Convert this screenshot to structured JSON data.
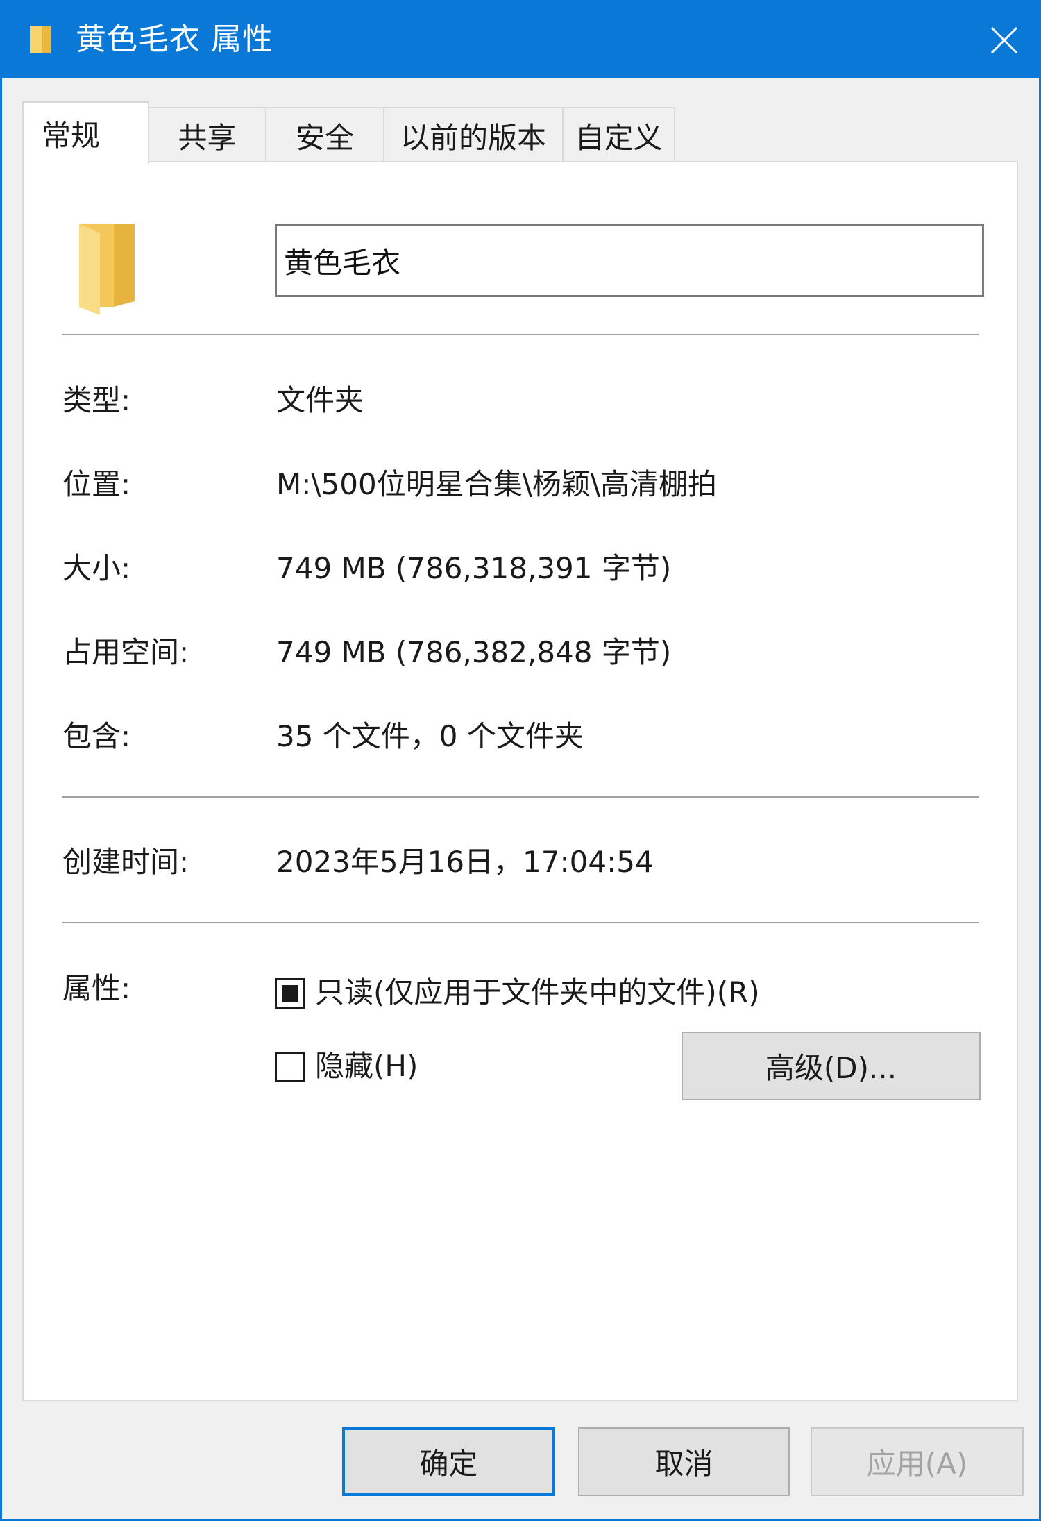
{
  "window": {
    "title": "黄色毛衣 属性",
    "accent_color": "#0a78d7",
    "close_icon": "close-icon"
  },
  "tabs": [
    {
      "label": "常规",
      "active": true
    },
    {
      "label": "共享",
      "active": false
    },
    {
      "label": "安全",
      "active": false
    },
    {
      "label": "以前的版本",
      "active": false
    },
    {
      "label": "自定义",
      "active": false
    }
  ],
  "general": {
    "folder_icon": "folder-icon",
    "name_value": "黄色毛衣",
    "rows": {
      "type": {
        "label": "类型:",
        "value": "文件夹"
      },
      "location": {
        "label": "位置:",
        "value": "M:\\500位明星合集\\杨颖\\高清棚拍"
      },
      "size": {
        "label": "大小:",
        "value": "749 MB (786,318,391 字节)"
      },
      "size_on_disk": {
        "label": "占用空间:",
        "value": "749 MB (786,382,848 字节)"
      },
      "contains": {
        "label": "包含:",
        "value": "35 个文件，0 个文件夹"
      },
      "created": {
        "label": "创建时间:",
        "value": "2023年5月16日，17:04:54"
      }
    },
    "attributes": {
      "label": "属性:",
      "readonly": {
        "label": "只读(仅应用于文件夹中的文件)(R)",
        "state": "indeterminate"
      },
      "hidden": {
        "label": "隐藏(H)",
        "state": "unchecked"
      },
      "advanced_button": "高级(D)..."
    }
  },
  "footer": {
    "ok": "确定",
    "cancel": "取消",
    "apply": "应用(A)"
  }
}
